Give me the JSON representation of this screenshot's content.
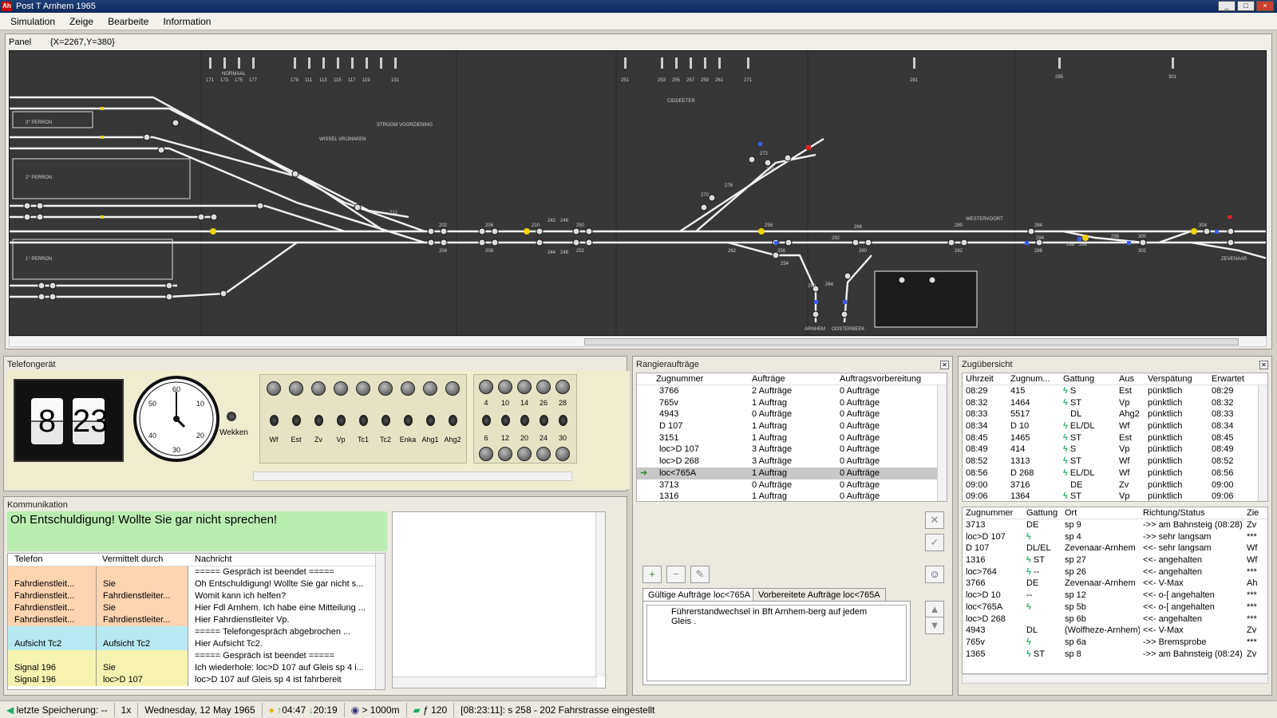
{
  "window": {
    "title": "Post T Arnhem 1965",
    "icon_text": "Ah",
    "minimize": "_",
    "maximize": "□",
    "close": "×"
  },
  "menu": [
    "Simulation",
    "Zeige",
    "Bearbeite",
    "Information"
  ],
  "panel": {
    "title": "Panel",
    "coords": "{X=2267,Y=380}"
  },
  "track_labels": {
    "perron3": "3° PERRON",
    "perron2": "2° PERRON",
    "perron1": "1° PERRON",
    "arnhem": "ARNHEM",
    "oosterbeek": "OOSTERBEEK",
    "westervoort": "WESTERVOORT",
    "zevenaar": "ZEVENAAR",
    "wissel": "WISSEL VRIJMAKEN",
    "stroom": "STROOM VOORZIENING",
    "ciddeeter": "CIDDEETER",
    "normaal": "NORMAAL"
  },
  "track_nums": [
    "171",
    "173",
    "175",
    "177",
    "179",
    "111",
    "113",
    "115",
    "117",
    "119",
    "131",
    "251",
    "253",
    "255",
    "257",
    "259",
    "261",
    "271",
    "281",
    "295",
    "301",
    "202",
    "204",
    "206",
    "208",
    "210",
    "212",
    "242",
    "244",
    "246",
    "248",
    "250",
    "252",
    "254",
    "256",
    "258",
    "260",
    "262",
    "264",
    "266",
    "270",
    "272",
    "274",
    "276",
    "280",
    "282",
    "284",
    "286",
    "288",
    "290",
    "292",
    "294",
    "296",
    "298",
    "300",
    "302",
    "304"
  ],
  "telefon": {
    "title": "Telefongerät",
    "hour": "8",
    "minute": "23",
    "dial_nums": [
      "60",
      "10",
      "20",
      "30",
      "40",
      "50"
    ],
    "wecker": "Wekken",
    "keys": [
      "Wf",
      "Est",
      "Zv",
      "Vp",
      "Tc1",
      "Tc2",
      "Enka",
      "Ahg1",
      "Ahg2"
    ],
    "num_top": [
      "4",
      "10",
      "14",
      "26",
      "28"
    ],
    "num_bottom": [
      "6",
      "12",
      "20",
      "24",
      "30"
    ]
  },
  "komm": {
    "title": "Kommunikation",
    "message": "Oh Entschuldigung! Wollte Sie gar nicht sprechen!",
    "headers": [
      "Telefon",
      "Vermittelt durch",
      "Nachricht"
    ],
    "rows": [
      {
        "t": "",
        "v": "",
        "n": "===== Gespräch ist beendet =====",
        "c": "#ffd4b0"
      },
      {
        "t": "Fahrdienstleit...",
        "v": "Sie",
        "n": "Oh Entschuldigung! Wollte Sie gar nicht s...",
        "c": "#ffd4b0"
      },
      {
        "t": "Fahrdienstleit...",
        "v": "Fahrdienstleiter...",
        "n": "Womit kann ich helfen?",
        "c": "#ffd4b0"
      },
      {
        "t": "Fahrdienstleit...",
        "v": "Sie",
        "n": "Hier Fdl Arnhem. Ich habe eine Mitteilung ...",
        "c": "#ffd4b0"
      },
      {
        "t": "Fahrdienstleit...",
        "v": "Fahrdienstleiter...",
        "n": "Hier Fahrdienstleiter Vp.",
        "c": "#ffd4b0"
      },
      {
        "t": "",
        "v": "",
        "n": "===== Telefongespräch abgebrochen ...",
        "c": "#b7e9f2"
      },
      {
        "t": "Aufsicht Tc2",
        "v": "Aufsicht Tc2",
        "n": "Hier Aufsicht Tc2.",
        "c": "#b7e9f2"
      },
      {
        "t": "",
        "v": "",
        "n": "===== Gespräch ist beendet =====",
        "c": "#f6f3b0"
      },
      {
        "t": "Signal 196",
        "v": "Sie",
        "n": "Ich wiederhole: loc>D 107 auf Gleis sp 4 i...",
        "c": "#f6f3b0"
      },
      {
        "t": "Signal 196",
        "v": "loc>D 107",
        "n": "loc>D 107 auf Gleis sp 4 ist fahrbereit",
        "c": "#f6f3b0"
      }
    ]
  },
  "rangier": {
    "title": "Rangieraufträge",
    "headers": [
      "Zugnummer",
      "Aufträge",
      "Auftragsvorbereitung"
    ],
    "rows": [
      {
        "z": "3766",
        "a": "2 Aufträge",
        "v": "0 Aufträge",
        "sel": false
      },
      {
        "z": "765v",
        "a": "1 Auftrag",
        "v": "0 Aufträge",
        "sel": false
      },
      {
        "z": "4943",
        "a": "0 Aufträge",
        "v": "0 Aufträge",
        "sel": false
      },
      {
        "z": "D 107",
        "a": "1 Auftrag",
        "v": "0 Aufträge",
        "sel": false
      },
      {
        "z": "3151",
        "a": "1 Auftrag",
        "v": "0 Aufträge",
        "sel": false
      },
      {
        "z": "loc>D 107",
        "a": "3 Aufträge",
        "v": "0 Aufträge",
        "sel": false
      },
      {
        "z": "loc>D 268",
        "a": "3 Aufträge",
        "v": "0 Aufträge",
        "sel": false
      },
      {
        "z": "loc<765A",
        "a": "1 Auftrag",
        "v": "0 Aufträge",
        "sel": true
      },
      {
        "z": "3713",
        "a": "0 Aufträge",
        "v": "0 Aufträge",
        "sel": false
      },
      {
        "z": "1316",
        "a": "1 Auftrag",
        "v": "0 Aufträge",
        "sel": false
      }
    ],
    "tab_valid": "Gültige Aufträge  loc<765A",
    "tab_prep": "Vorbereitete Aufträge  loc<765A",
    "task_text": "Führerstandwechsel in Bft Arnhem-berg auf jedem Gleis ."
  },
  "zug": {
    "title": "Zugübersicht",
    "headers": [
      "Uhrzeit",
      "Zugnum...",
      "Gattung",
      "Aus",
      "Verspätung",
      "Erwartet"
    ],
    "rows": [
      {
        "u": "08:29",
        "z": "415",
        "g": "S",
        "a": "Est",
        "v": "pünktlich",
        "e": "08:29",
        "b": true
      },
      {
        "u": "08:32",
        "z": "1464",
        "g": "ST",
        "a": "Vp",
        "v": "pünktlich",
        "e": "08:32",
        "b": true
      },
      {
        "u": "08:33",
        "z": "5517",
        "g": "DL",
        "a": "Ahg2",
        "v": "pünktlich",
        "e": "08:33",
        "b": false
      },
      {
        "u": "08:34",
        "z": "D 10",
        "g": "EL/DL",
        "a": "Wf",
        "v": "pünktlich",
        "e": "08:34",
        "b": true
      },
      {
        "u": "08:45",
        "z": "1465",
        "g": "ST",
        "a": "Est",
        "v": "pünktlich",
        "e": "08:45",
        "b": true
      },
      {
        "u": "08:49",
        "z": "414",
        "g": "S",
        "a": "Vp",
        "v": "pünktlich",
        "e": "08:49",
        "b": true
      },
      {
        "u": "08:52",
        "z": "1313",
        "g": "ST",
        "a": "Wf",
        "v": "pünktlich",
        "e": "08:52",
        "b": true
      },
      {
        "u": "08:56",
        "z": "D 268",
        "g": "EL/DL",
        "a": "Wf",
        "v": "pünktlich",
        "e": "08:56",
        "b": true
      },
      {
        "u": "09:00",
        "z": "3716",
        "g": "DE",
        "a": "Zv",
        "v": "pünktlich",
        "e": "09:00",
        "b": false
      },
      {
        "u": "09:06",
        "z": "1364",
        "g": "ST",
        "a": "Vp",
        "v": "pünktlich",
        "e": "09:06",
        "b": true
      }
    ],
    "headers2": [
      "Zugnummer",
      "Gattung",
      "Ort",
      "Richtung/Status",
      "Zie"
    ],
    "rows2": [
      {
        "z": "3713",
        "g": "DE",
        "o": "sp 9",
        "r": "->> am Bahnsteig (08:28)",
        "x": "Zv",
        "b": false
      },
      {
        "z": "loc>D 107",
        "g": "",
        "o": "sp 4",
        "r": "->> sehr langsam",
        "x": "***",
        "b": true
      },
      {
        "z": "D 107",
        "g": "DL/EL",
        "o": "Zevenaar-Arnhem",
        "r": "<<- sehr langsam",
        "x": "Wf",
        "b": false
      },
      {
        "z": "1316",
        "g": "ST",
        "o": "sp 27",
        "r": "<<- angehalten",
        "x": "Wf",
        "b": true
      },
      {
        "z": "loc>764",
        "g": "--",
        "o": "sp 26",
        "r": "<<- angehalten",
        "x": "***",
        "b": true
      },
      {
        "z": "3766",
        "g": "DE",
        "o": "Zevenaar-Arnhem",
        "r": "<<- V-Max",
        "x": "Ah",
        "b": false
      },
      {
        "z": "loc>D 10",
        "g": "--",
        "o": "sp 12",
        "r": "<<- o-[ angehalten",
        "x": "***",
        "b": false
      },
      {
        "z": "loc<765A",
        "g": "",
        "o": "sp 5b",
        "r": "<<- o-[ angehalten",
        "x": "***",
        "b": true
      },
      {
        "z": "loc>D 268",
        "g": "",
        "o": "sp 6b",
        "r": "<<- angehalten",
        "x": "***",
        "b": false
      },
      {
        "z": "4943",
        "g": "DL",
        "o": "(Wolfheze-Arnhem)",
        "r": "<<- V-Max",
        "x": "Zv",
        "b": false
      },
      {
        "z": "765v",
        "g": "",
        "o": "sp 6a",
        "r": "->> Bremsprobe",
        "x": "***",
        "b": true
      },
      {
        "z": "1365",
        "g": "ST",
        "o": "sp 8",
        "r": "->> am Bahnsteig (08:24)",
        "x": "Zv",
        "b": true
      }
    ]
  },
  "status": {
    "save": "letzte Speicherung:  --",
    "speed": "1x",
    "date": "Wednesday, 12 May 1965",
    "sunrise": "04:47",
    "sunset": "20:19",
    "view": "> 1000m",
    "temp": "ƒ 120",
    "message": "[08:23:11]: s 258 - 202 Fahrstrasse eingestellt"
  }
}
